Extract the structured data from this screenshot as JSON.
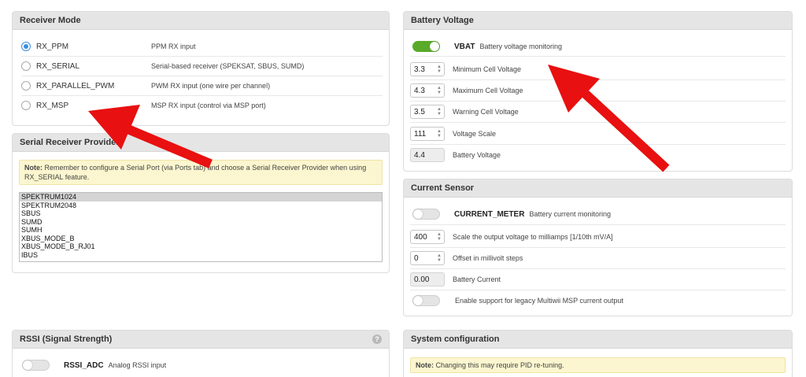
{
  "receiver_mode": {
    "title": "Receiver Mode",
    "options": [
      {
        "label": "RX_PPM",
        "desc": "PPM RX input",
        "checked": true
      },
      {
        "label": "RX_SERIAL",
        "desc": "Serial-based receiver (SPEKSAT, SBUS, SUMD)",
        "checked": false
      },
      {
        "label": "RX_PARALLEL_PWM",
        "desc": "PWM RX input (one wire per channel)",
        "checked": false
      },
      {
        "label": "RX_MSP",
        "desc": "MSP RX input (control via MSP port)",
        "checked": false
      }
    ]
  },
  "serial_receiver": {
    "title": "Serial Receiver Provider",
    "note_bold": "Note:",
    "note_text": " Remember to configure a Serial Port (via Ports tab) and choose a Serial Receiver Provider when using RX_SERIAL feature.",
    "providers": [
      "SPEKTRUM1024",
      "SPEKTRUM2048",
      "SBUS",
      "SUMD",
      "SUMH",
      "XBUS_MODE_B",
      "XBUS_MODE_B_RJ01",
      "IBUS"
    ],
    "selected": "SPEKTRUM1024"
  },
  "rssi": {
    "title": "RSSI (Signal Strength)",
    "help": "?",
    "toggle_key": "RSSI_ADC",
    "toggle_desc": "Analog RSSI input",
    "toggle_on": false
  },
  "battery": {
    "title": "Battery Voltage",
    "toggle_key": "VBAT",
    "toggle_desc": "Battery voltage monitoring",
    "toggle_on": true,
    "fields": [
      {
        "value": "3.3",
        "label": "Minimum Cell Voltage"
      },
      {
        "value": "4.3",
        "label": "Maximum Cell Voltage"
      },
      {
        "value": "3.5",
        "label": "Warning Cell Voltage"
      },
      {
        "value": "111",
        "label": "Voltage Scale"
      }
    ],
    "readout": {
      "value": "4.4",
      "label": "Battery Voltage"
    }
  },
  "current_sensor": {
    "title": "Current Sensor",
    "toggle_key": "CURRENT_METER",
    "toggle_desc": "Battery current monitoring",
    "toggle_on": false,
    "fields": [
      {
        "value": "400",
        "label": "Scale the output voltage to milliamps [1/10th mV/A]"
      },
      {
        "value": "0",
        "label": "Offset in millivolt steps"
      }
    ],
    "readout": {
      "value": "0.00",
      "label": "Battery Current"
    },
    "legacy_label": "Enable support for legacy Multiwii MSP current output",
    "legacy_on": false
  },
  "system_config": {
    "title": "System configuration",
    "note_bold": "Note:",
    "note_text": " Changing this may require PID re-tuning."
  },
  "colors": {
    "annotation_arrow": "#e81010",
    "toggle_on": "#59aa29",
    "radio_selected": "#3b8fe0"
  }
}
